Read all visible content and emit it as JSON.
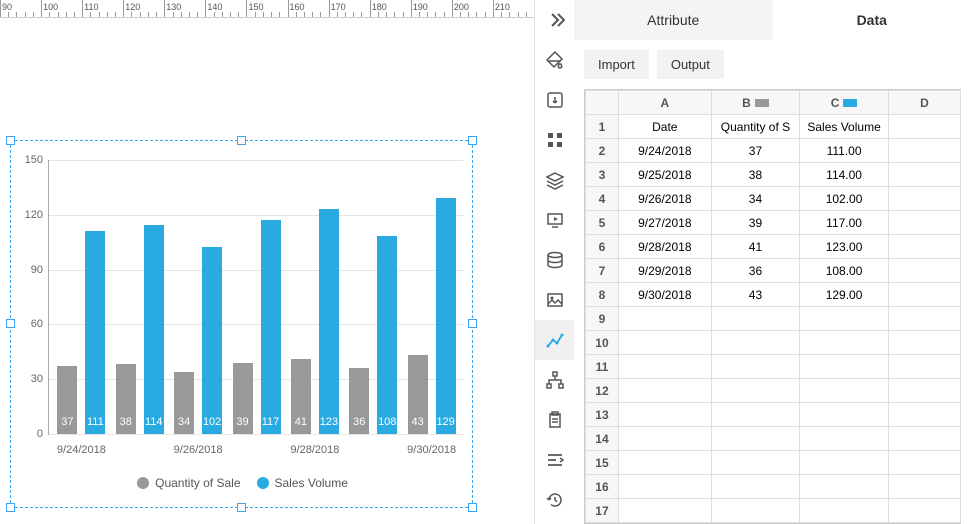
{
  "ruler": {
    "start": 90,
    "end": 220,
    "step": 10
  },
  "chart_data": {
    "type": "bar",
    "categories": [
      "9/24/2018",
      "9/25/2018",
      "9/26/2018",
      "9/27/2018",
      "9/28/2018",
      "9/29/2018",
      "9/30/2018"
    ],
    "series": [
      {
        "name": "Quantity of Sale",
        "color": "#999999",
        "values": [
          37,
          38,
          34,
          39,
          41,
          36,
          43
        ]
      },
      {
        "name": "Sales Volume",
        "color": "#29abe2",
        "values": [
          111,
          114,
          102,
          117,
          123,
          108,
          129
        ]
      }
    ],
    "ylim": [
      0,
      150
    ],
    "ystep": 30,
    "x_ticks_shown": [
      "9/24/2018",
      "9/26/2018",
      "9/28/2018",
      "9/30/2018"
    ],
    "title": "",
    "xlabel": "",
    "ylabel": ""
  },
  "panel": {
    "tab_attribute": "Attribute",
    "tab_data": "Data",
    "import_label": "Import",
    "output_label": "Output"
  },
  "sheet": {
    "columns": [
      "A",
      "B",
      "C",
      "D"
    ],
    "series_colors": {
      "B": "#999999",
      "C": "#29abe2"
    },
    "headers": {
      "A": "Date",
      "B": "Quantity of S",
      "C": "Sales Volume",
      "D": ""
    },
    "rows": [
      {
        "n": 1,
        "A": "Date",
        "B": "Quantity of S",
        "C": "Sales Volume",
        "D": ""
      },
      {
        "n": 2,
        "A": "9/24/2018",
        "B": "37",
        "C": "111.00",
        "D": ""
      },
      {
        "n": 3,
        "A": "9/25/2018",
        "B": "38",
        "C": "114.00",
        "D": ""
      },
      {
        "n": 4,
        "A": "9/26/2018",
        "B": "34",
        "C": "102.00",
        "D": ""
      },
      {
        "n": 5,
        "A": "9/27/2018",
        "B": "39",
        "C": "117.00",
        "D": ""
      },
      {
        "n": 6,
        "A": "9/28/2018",
        "B": "41",
        "C": "123.00",
        "D": ""
      },
      {
        "n": 7,
        "A": "9/29/2018",
        "B": "36",
        "C": "108.00",
        "D": ""
      },
      {
        "n": 8,
        "A": "9/30/2018",
        "B": "43",
        "C": "129.00",
        "D": ""
      },
      {
        "n": 9,
        "A": "",
        "B": "",
        "C": "",
        "D": ""
      },
      {
        "n": 10,
        "A": "",
        "B": "",
        "C": "",
        "D": ""
      },
      {
        "n": 11,
        "A": "",
        "B": "",
        "C": "",
        "D": ""
      },
      {
        "n": 12,
        "A": "",
        "B": "",
        "C": "",
        "D": ""
      },
      {
        "n": 13,
        "A": "",
        "B": "",
        "C": "",
        "D": ""
      },
      {
        "n": 14,
        "A": "",
        "B": "",
        "C": "",
        "D": ""
      },
      {
        "n": 15,
        "A": "",
        "B": "",
        "C": "",
        "D": ""
      },
      {
        "n": 16,
        "A": "",
        "B": "",
        "C": "",
        "D": ""
      },
      {
        "n": 17,
        "A": "",
        "B": "",
        "C": "",
        "D": ""
      }
    ]
  },
  "toolbar": {
    "items": [
      {
        "name": "collapse-icon"
      },
      {
        "name": "fill-icon"
      },
      {
        "name": "export-icon"
      },
      {
        "name": "grid-icon"
      },
      {
        "name": "layers-icon"
      },
      {
        "name": "slideshow-icon"
      },
      {
        "name": "database-icon"
      },
      {
        "name": "image-icon"
      },
      {
        "name": "chart-icon",
        "active": true
      },
      {
        "name": "tree-icon"
      },
      {
        "name": "clipboard-icon"
      },
      {
        "name": "align-icon"
      },
      {
        "name": "history-icon"
      }
    ]
  }
}
